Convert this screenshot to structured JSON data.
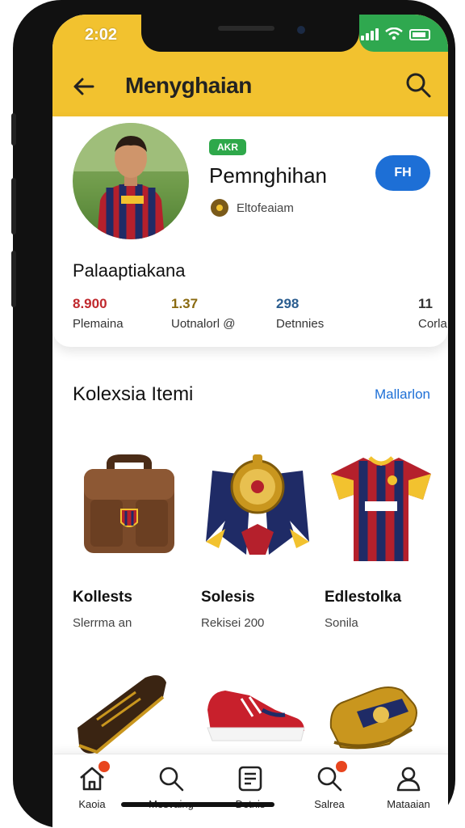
{
  "status": {
    "time": "2:02"
  },
  "header": {
    "title": "Menyghaian"
  },
  "profile": {
    "badge": "AKR",
    "name": "Pemnghihan",
    "brand": "Eltofeaiam",
    "follow_label": "FH",
    "subtitle": "Palaaptiakana",
    "stats": [
      {
        "value": "8.900",
        "label": "Plemaina",
        "color": "#c0282d"
      },
      {
        "value": "1.37",
        "label": "Uotnalorl @",
        "color": "#8a6a10"
      },
      {
        "value": "298",
        "label": "Detnnies",
        "color": "#2a5d8f"
      },
      {
        "value": "11",
        "label": "Corla",
        "color": "#333333"
      }
    ]
  },
  "section": {
    "title": "Kolexsia Itemi",
    "link": "Mallarlon"
  },
  "items": [
    {
      "title": "Kollests",
      "subtitle": "Slerrma an",
      "icon": "leather-bag-icon"
    },
    {
      "title": "Solesis",
      "subtitle": "Rekisei 200",
      "icon": "medal-scarf-icon"
    },
    {
      "title": "Edlestolka",
      "subtitle": "Sonila",
      "icon": "jersey-icon"
    },
    {
      "icon": "book-box-icon"
    },
    {
      "icon": "sneaker-icon"
    },
    {
      "icon": "golden-boot-icon"
    }
  ],
  "nav": [
    {
      "label": "Kaoia",
      "icon": "home-icon"
    },
    {
      "label": "Mesvaing",
      "icon": "search-icon"
    },
    {
      "label": "Detnis",
      "icon": "list-icon"
    },
    {
      "label": "Salrea",
      "icon": "search-icon"
    },
    {
      "label": "Mataaian",
      "icon": "profile-icon"
    }
  ],
  "colors": {
    "header": "#f2c22f",
    "accent_blue": "#1d6fd6",
    "badge_green": "#2ea84a",
    "notification": "#e8451e"
  }
}
